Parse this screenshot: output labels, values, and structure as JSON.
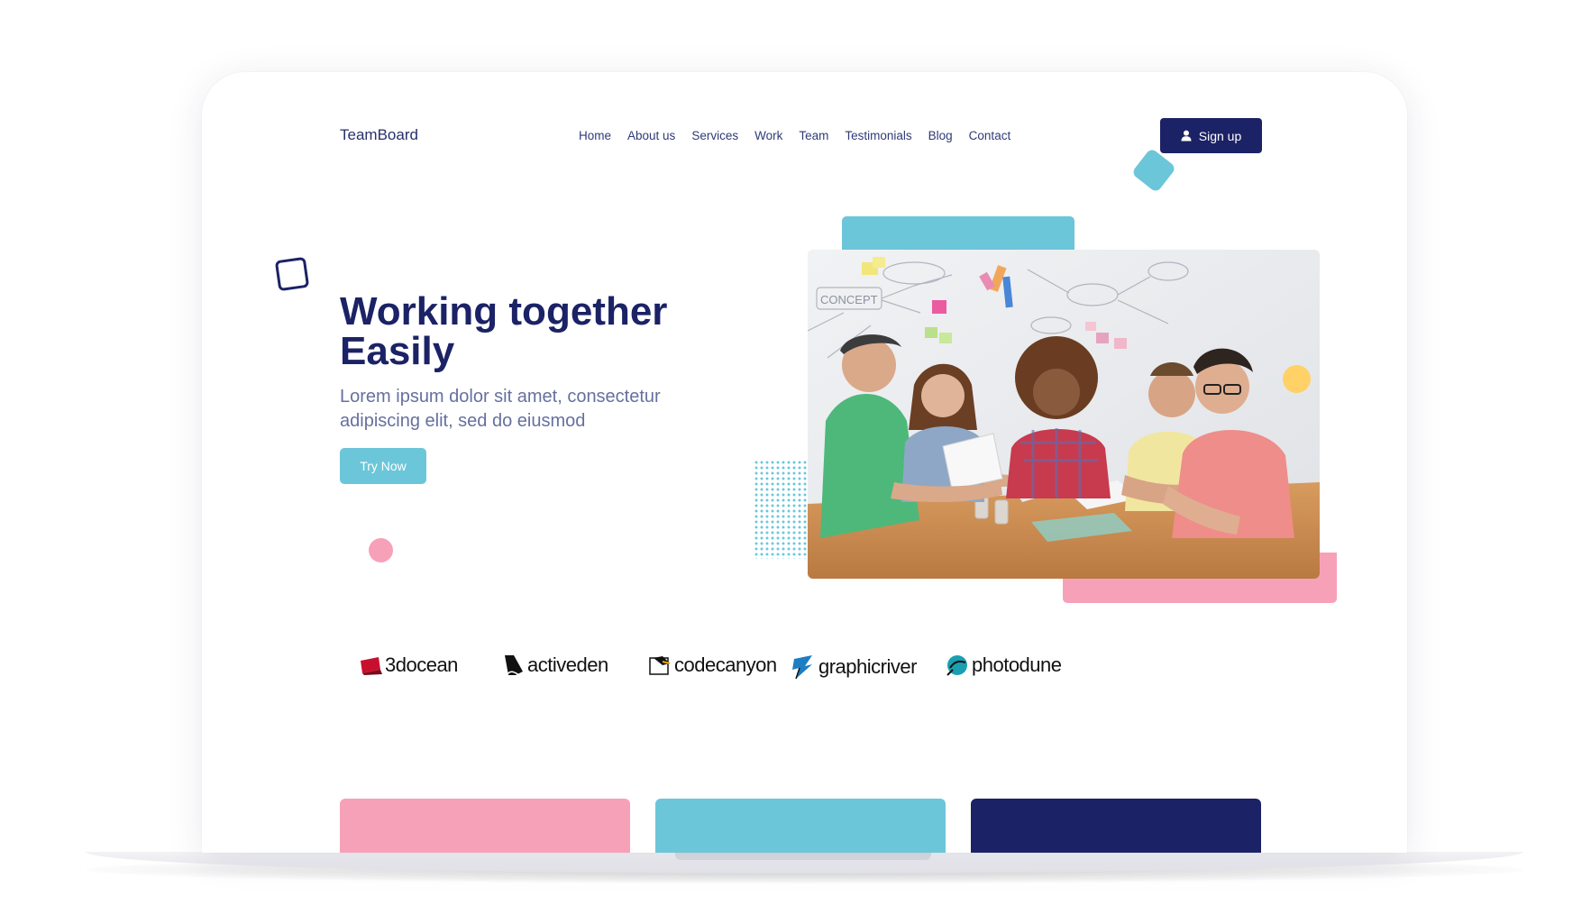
{
  "header": {
    "logo": "TeamBoard",
    "nav": [
      "Home",
      "About us",
      "Services",
      "Work",
      "Team",
      "Testimonials",
      "Blog",
      "Contact"
    ],
    "signup_label": "Sign up"
  },
  "hero": {
    "title_line1": "Working together",
    "title_line2": "Easily",
    "subtitle_line1": "Lorem ipsum dolor sit amet, consectetur",
    "subtitle_line2": "adipiscing elit, sed do eiusmod",
    "cta_label": "Try Now"
  },
  "brands": [
    "3docean",
    "activeden",
    "codecanyon",
    "graphicriver",
    "photodune"
  ],
  "icons": {
    "signup": "user-icon",
    "brand_3docean": "3docean-logo-icon",
    "brand_activeden": "activeden-logo-icon",
    "brand_codecanyon": "codecanyon-logo-icon",
    "brand_graphicriver": "graphicriver-logo-icon",
    "brand_photodune": "photodune-logo-icon"
  },
  "colors": {
    "primary_navy": "#1b2266",
    "accent_teal": "#6cc6d9",
    "accent_pink": "#f7a1b8",
    "accent_yellow": "#ffd166",
    "text_muted": "#66709f"
  }
}
